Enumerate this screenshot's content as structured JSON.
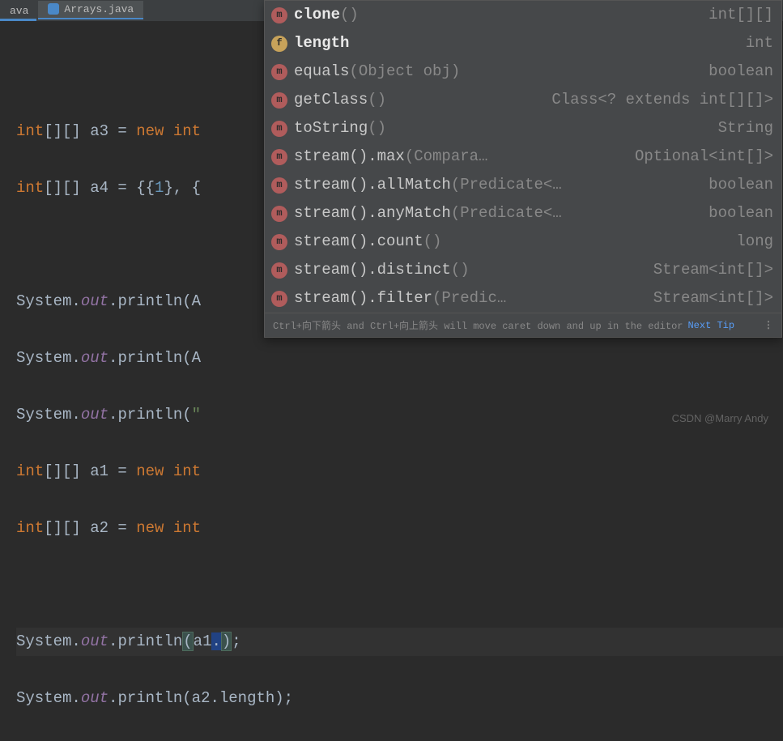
{
  "tabs": {
    "t0_label": "ava",
    "t1_label": "Arrays.java"
  },
  "code": {
    "l1_a": "int",
    "l1_b": "[][] a3 = ",
    "l1_c": "new ",
    "l1_d": "int",
    "l2_a": "int",
    "l2_b": "[][] a4 = {{",
    "l2_c": "1",
    "l2_d": "}, {",
    "l4_a": "System.",
    "l4_b": "out",
    "l4_c": ".println(A",
    "l5_a": "System.",
    "l5_b": "out",
    "l5_c": ".println(A",
    "l6_a": "System.",
    "l6_b": "out",
    "l6_c": ".println(",
    "l6_d": "\"",
    "l7_a": "int",
    "l7_b": "[][] a1 = ",
    "l7_c": "new ",
    "l7_d": "int",
    "l8_a": "int",
    "l8_b": "[][] a2 = ",
    "l8_c": "new ",
    "l8_d": "int",
    "l10_a": "System.",
    "l10_b": "out",
    "l10_c": ".println",
    "l10_d": "(",
    "l10_e": "a1",
    "l10_f": ".",
    "l10_g": ")",
    "l10_h": ";",
    "l11_a": "System.",
    "l11_b": "out",
    "l11_c": ".println(a2.length);"
  },
  "popup": {
    "items": [
      {
        "kind": "m",
        "name": "clone",
        "params": "()",
        "ret": "int[][]",
        "bold": true
      },
      {
        "kind": "f",
        "name": "length",
        "params": "",
        "ret": "int",
        "bold": true
      },
      {
        "kind": "m",
        "name": "equals",
        "params": "(Object obj)",
        "ret": "boolean",
        "bold": false
      },
      {
        "kind": "m",
        "name": "getClass",
        "params": "()",
        "ret": "Class<? extends int[][]>",
        "bold": false
      },
      {
        "kind": "m",
        "name": "toString",
        "params": "()",
        "ret": "String",
        "bold": false
      },
      {
        "kind": "m",
        "name": "stream().max",
        "params": "(Compara…",
        "ret": "Optional<int[]>",
        "bold": false
      },
      {
        "kind": "m",
        "name": "stream().allMatch",
        "params": "(Predicate<…",
        "ret": "boolean",
        "bold": false
      },
      {
        "kind": "m",
        "name": "stream().anyMatch",
        "params": "(Predicate<…",
        "ret": "boolean",
        "bold": false
      },
      {
        "kind": "m",
        "name": "stream().count",
        "params": "()",
        "ret": "long",
        "bold": false
      },
      {
        "kind": "m",
        "name": "stream().distinct",
        "params": "()",
        "ret": "Stream<int[]>",
        "bold": false
      },
      {
        "kind": "m",
        "name": "stream().filter",
        "params": "(Predic…",
        "ret": "Stream<int[]>",
        "bold": false
      }
    ],
    "hint_left": "Ctrl+向下箭头 and Ctrl+向上箭头 will move caret down and up in the editor",
    "hint_link": "Next Tip"
  },
  "watermark1": "CSDN @Marry Andy",
  "watermark2": ""
}
